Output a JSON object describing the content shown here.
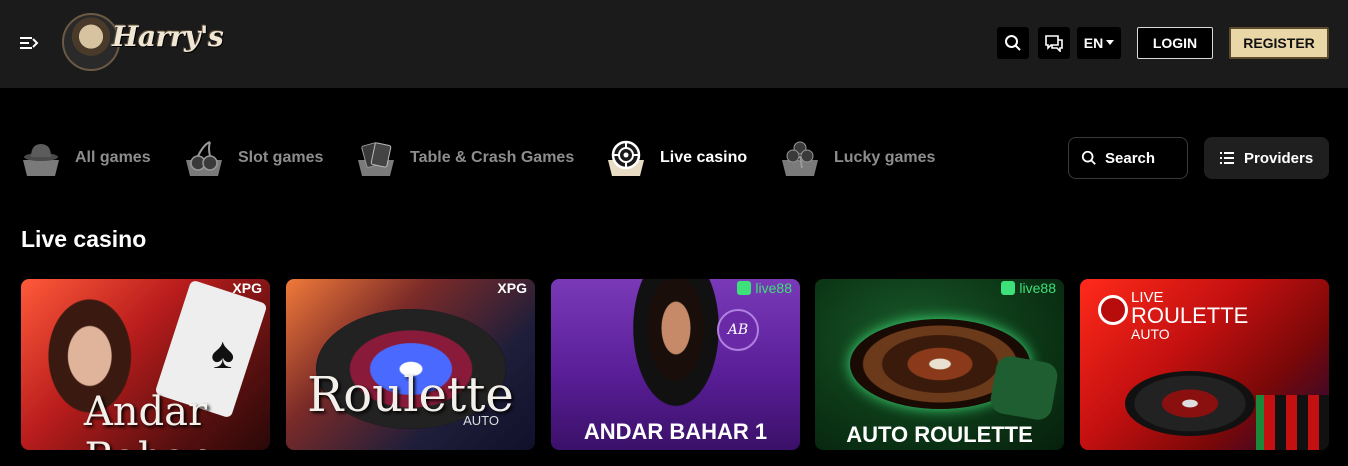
{
  "header": {
    "logo_text": "Harry's",
    "lang": "EN",
    "login_label": "LOGIN",
    "register_label": "REGISTER"
  },
  "categories": [
    {
      "label": "All games",
      "icon": "hat-icon",
      "active": false
    },
    {
      "label": "Slot games",
      "icon": "cherries-icon",
      "active": false
    },
    {
      "label": "Table & Crash Games",
      "icon": "cards-icon",
      "active": false
    },
    {
      "label": "Live casino",
      "icon": "roulette-wheel-icon",
      "active": true
    },
    {
      "label": "Lucky games",
      "icon": "clover-icon",
      "active": false
    }
  ],
  "search_label": "Search",
  "providers_label": "Providers",
  "section_title": "Live casino",
  "games": [
    {
      "title": "Andar Bahar",
      "provider": "XPG"
    },
    {
      "title": "Roulette",
      "subtitle": "AUTO",
      "provider": "XPG"
    },
    {
      "title": "ANDAR BAHAR 1",
      "provider": "live88",
      "badge": "AB"
    },
    {
      "title": "AUTO ROULETTE",
      "provider": "live88"
    },
    {
      "title_top": "LIVE",
      "title": "ROULETTE",
      "subtitle": "AUTO"
    }
  ],
  "colors": {
    "header_bg": "#1b1b1b",
    "register_bg": "#e9d7a8",
    "inactive_text": "#8d8d8d",
    "live88_green": "#3ee07a"
  }
}
